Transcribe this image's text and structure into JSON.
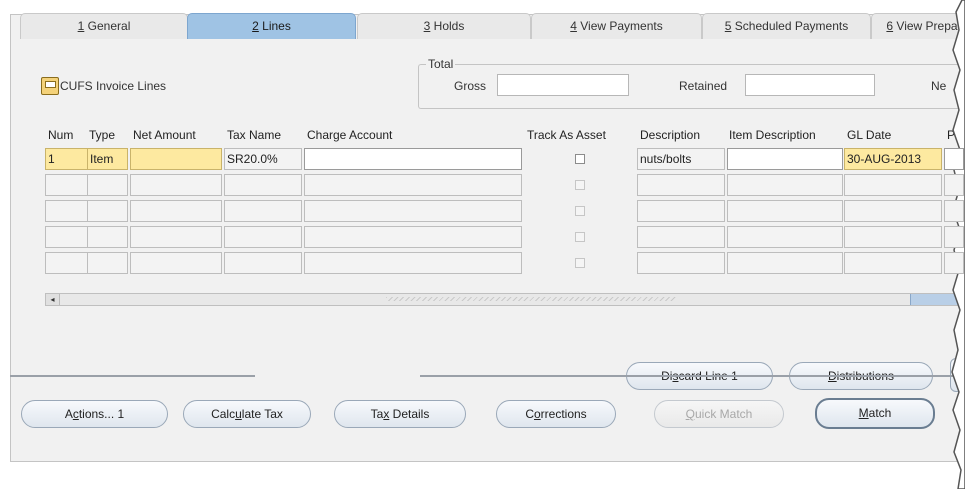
{
  "tabs": [
    {
      "num": "1",
      "rest": " General",
      "active": false
    },
    {
      "num": "2",
      "rest": " Lines",
      "active": true
    },
    {
      "num": "3",
      "rest": " Holds",
      "active": false
    },
    {
      "num": "4",
      "rest": " View Payments",
      "active": false
    },
    {
      "num": "5",
      "rest": " Scheduled Payments",
      "active": false
    },
    {
      "num": "6",
      "rest": " View Prepa",
      "active": false
    }
  ],
  "region": {
    "title": "CUFS Invoice Lines"
  },
  "totals": {
    "group_label": "Total",
    "gross_label": "Gross",
    "gross_value": "",
    "retained_label": "Retained",
    "retained_value": "",
    "net_label": "Ne"
  },
  "grid": {
    "columns": [
      "Num",
      "Type",
      "Net Amount",
      "Tax Name",
      "Charge Account",
      "Track As Asset",
      "Description",
      "Item Description",
      "GL Date",
      "P"
    ],
    "rows": [
      {
        "num": "1",
        "type": "Item",
        "net_amount": "",
        "tax_name": "SR20.0%",
        "charge_account": "",
        "track_as_asset": false,
        "description": "nuts/bolts",
        "item_description": "",
        "gl_date": "30-AUG-2013"
      },
      {
        "num": "",
        "type": "",
        "net_amount": "",
        "tax_name": "",
        "charge_account": "",
        "track_as_asset": false,
        "description": "",
        "item_description": "",
        "gl_date": ""
      },
      {
        "num": "",
        "type": "",
        "net_amount": "",
        "tax_name": "",
        "charge_account": "",
        "track_as_asset": false,
        "description": "",
        "item_description": "",
        "gl_date": ""
      },
      {
        "num": "",
        "type": "",
        "net_amount": "",
        "tax_name": "",
        "charge_account": "",
        "track_as_asset": false,
        "description": "",
        "item_description": "",
        "gl_date": ""
      },
      {
        "num": "",
        "type": "",
        "net_amount": "",
        "tax_name": "",
        "charge_account": "",
        "track_as_asset": false,
        "description": "",
        "item_description": "",
        "gl_date": ""
      }
    ]
  },
  "scroll": {
    "left_arrow": "◂"
  },
  "line_buttons": [
    {
      "pre": "Di",
      "key": "s",
      "post": "card Line 1",
      "disabled": false
    },
    {
      "pre": "",
      "key": "D",
      "post": "istributions",
      "disabled": false
    },
    {
      "pre": "",
      "key": "",
      "post": "",
      "disabled": false
    }
  ],
  "action_buttons": [
    {
      "pre": "A",
      "key": "c",
      "post": "tions... 1",
      "disabled": false,
      "default": false
    },
    {
      "pre": "Calc",
      "key": "u",
      "post": "late Tax",
      "disabled": false,
      "default": false
    },
    {
      "pre": "Ta",
      "key": "x",
      "post": " Details",
      "disabled": false,
      "default": false
    },
    {
      "pre": "C",
      "key": "o",
      "post": "rrections",
      "disabled": false,
      "default": false
    },
    {
      "pre": "",
      "key": "Q",
      "post": "uick Match",
      "disabled": true,
      "default": false
    },
    {
      "pre": "",
      "key": "M",
      "post": "atch",
      "disabled": false,
      "default": true
    }
  ]
}
